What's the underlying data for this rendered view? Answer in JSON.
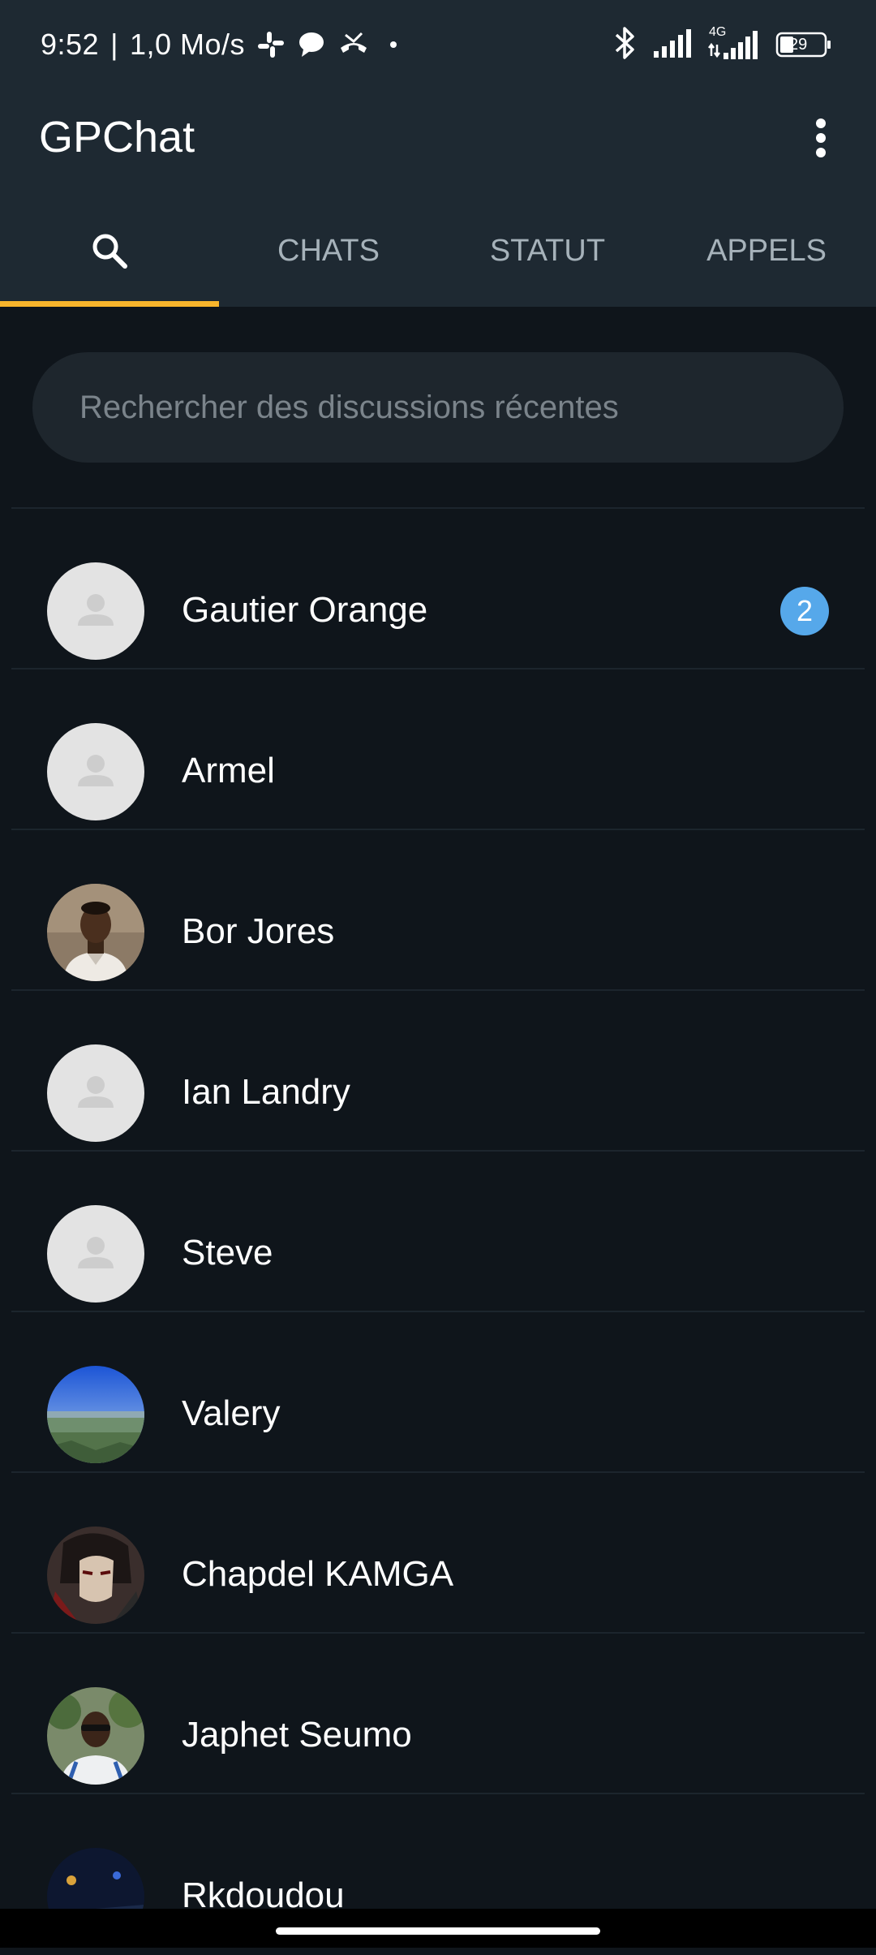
{
  "status_bar": {
    "time": "9:52",
    "speed": "1,0 Mo/s",
    "network_label": "4G",
    "battery": "29",
    "icons": [
      "slack-icon",
      "message-icon",
      "missed-call-icon",
      "dot-icon",
      "bluetooth-icon",
      "signal-icon",
      "battery-icon"
    ]
  },
  "app_bar": {
    "title": "GPChat",
    "menu_icon": "more-vert-icon"
  },
  "tabs": [
    {
      "label": "",
      "icon": "search-icon",
      "active": true
    },
    {
      "label": "CHATS",
      "active": false
    },
    {
      "label": "STATUT",
      "active": false
    },
    {
      "label": "APPELS",
      "active": false
    }
  ],
  "search": {
    "placeholder": "Rechercher des discussions récentes",
    "value": ""
  },
  "contacts": [
    {
      "name": "Gautier Orange",
      "avatar": "default",
      "badge": "2"
    },
    {
      "name": "Armel",
      "avatar": "default"
    },
    {
      "name": "Bor Jores",
      "avatar": "photo-man-white-shirt"
    },
    {
      "name": "Ian Landry",
      "avatar": "default"
    },
    {
      "name": "Steve",
      "avatar": "default"
    },
    {
      "name": "Valery",
      "avatar": "photo-landscape"
    },
    {
      "name": "Chapdel KAMGA",
      "avatar": "photo-anime"
    },
    {
      "name": "Japhet Seumo",
      "avatar": "photo-man-sunglasses"
    },
    {
      "name": "Rkdoudou",
      "avatar": "photo-night"
    }
  ],
  "colors": {
    "header_bg": "#1e2932",
    "body_bg": "#0f151b",
    "tab_indicator": "#f7b52c",
    "badge": "#56a8ea",
    "search_bg": "#1e262d"
  }
}
